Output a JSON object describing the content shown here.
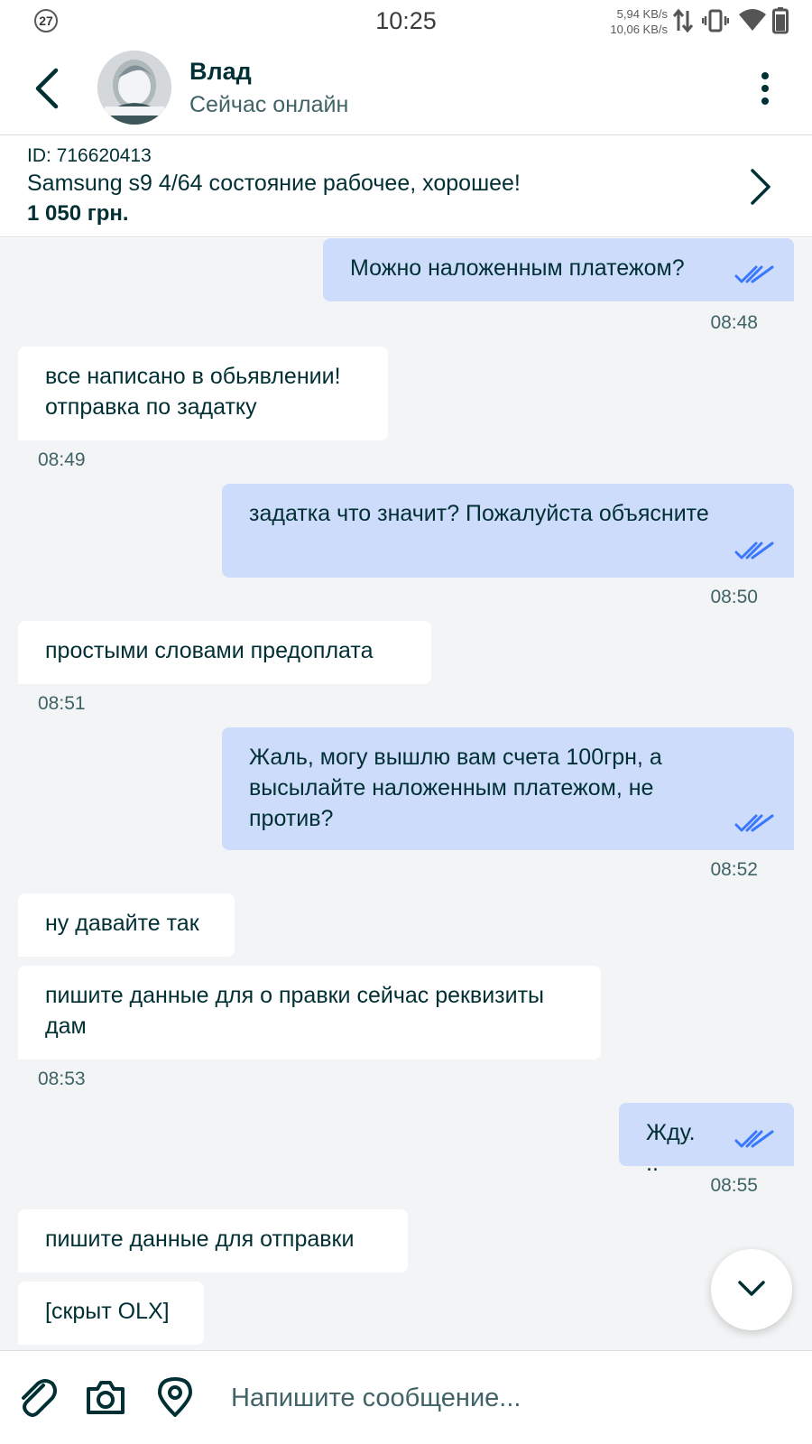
{
  "status_bar": {
    "notification_count": "27",
    "time": "10:25",
    "net_up": "5,94 KB/s",
    "net_down": "10,06 KB/s",
    "icons": [
      "data-transfer-icon",
      "vibrate-icon",
      "wifi-icon",
      "battery-icon"
    ]
  },
  "header": {
    "contact_name": "Влад",
    "contact_status": "Сейчас онлайн"
  },
  "ad": {
    "id": "ID: 716620413",
    "title": "Samsung s9 4/64 состояние рабочее, хорошее!",
    "price": "1 050 грн."
  },
  "messages": [
    {
      "direction": "out",
      "text": "Можно наложенным платежом?",
      "time": "08:48",
      "read": true
    },
    {
      "direction": "in",
      "text": "все написано в обьявлении! отправка по задатку",
      "time": "08:49"
    },
    {
      "direction": "out",
      "text": "задатка что значит? Пожалуйста объясните",
      "time": "08:50",
      "read": true
    },
    {
      "direction": "in",
      "text": "простыми словами предоплата",
      "time": "08:51"
    },
    {
      "direction": "out",
      "text": "Жаль, могу вышлю вам счета 100грн, а высылайте наложенным платежом, не против?",
      "time": "08:52",
      "read": true
    },
    {
      "direction": "in",
      "text": "ну давайте так",
      "time": ""
    },
    {
      "direction": "in",
      "text": "пишите данные для о правки сейчас реквизиты дам",
      "time": "08:53"
    },
    {
      "direction": "out",
      "text": "Жду. ..",
      "time": "08:55",
      "read": true
    },
    {
      "direction": "in",
      "text": "пишите данные для отправки",
      "time": ""
    },
    {
      "direction": "in",
      "text": "[скрыт OLX]",
      "time": ""
    }
  ],
  "composer": {
    "placeholder": "Напишите сообщение...",
    "value": ""
  },
  "colors": {
    "text_primary": "#002f34",
    "outgoing_bubble": "#cedcfb",
    "incoming_bubble": "#ffffff",
    "chat_background": "#f2f4f5",
    "read_check": "#3a77ff"
  }
}
